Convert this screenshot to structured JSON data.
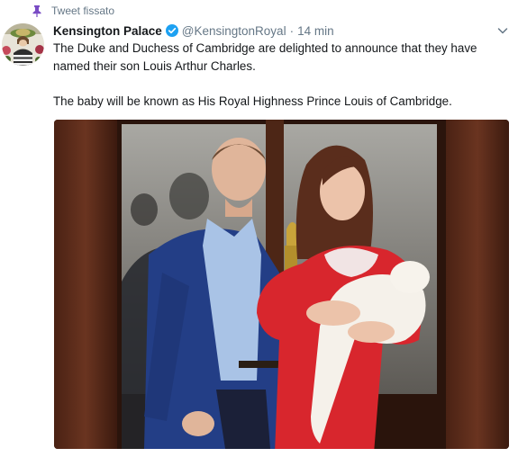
{
  "pinned": {
    "label": "Tweet fissato",
    "icon": "pin-icon"
  },
  "tweet": {
    "display_name": "Kensington Palace",
    "handle": "@KensingtonRoyal",
    "separator": "·",
    "time": "14 min",
    "text_1": "The Duke and Duchess of Cambridge are delighted to announce that they have named their son Louis Arthur Charles.",
    "text_2": "The baby will be known as His Royal Highness Prince Louis of Cambridge."
  },
  "colors": {
    "verified": "#1da1f2",
    "pin": "#794bc4",
    "muted": "#657786"
  }
}
